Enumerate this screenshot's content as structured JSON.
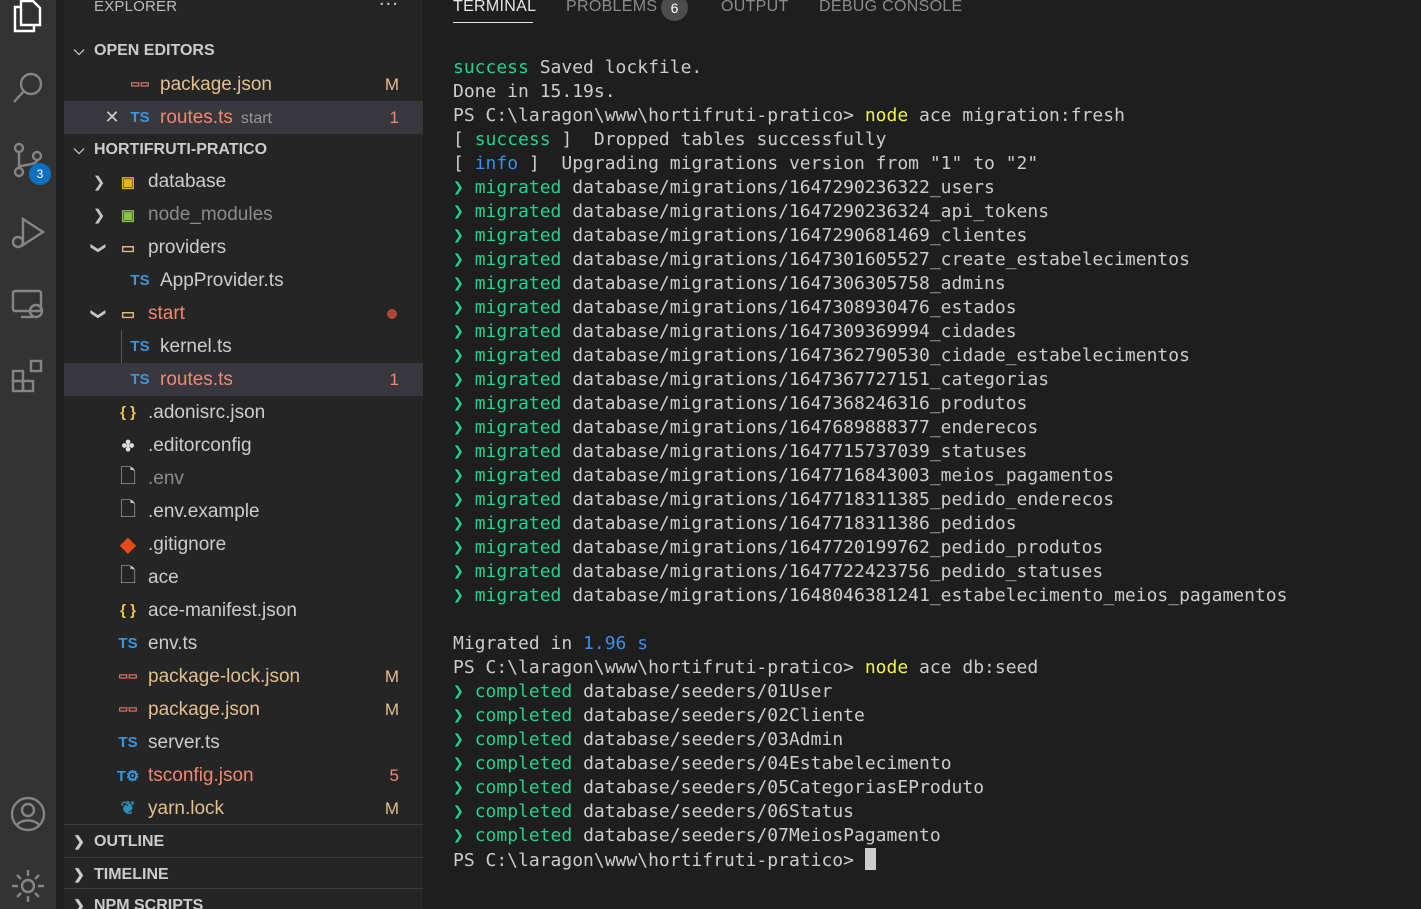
{
  "explorer": {
    "title": "EXPLORER",
    "more": "···",
    "open_editors": {
      "header": "OPEN EDITORS",
      "items": [
        {
          "label": "package.json",
          "decoration": "M",
          "icon": "json-icon"
        },
        {
          "label": "routes.ts",
          "sub": "start",
          "decoration": "1",
          "icon": "ts-icon"
        }
      ]
    },
    "project": {
      "header": "HORTIFRUTI-PRATICO",
      "items": [
        {
          "label": "database",
          "icon": "folder-database-icon"
        },
        {
          "label": "node_modules",
          "icon": "folder-node-icon"
        },
        {
          "label": "providers",
          "icon": "folder-open-icon"
        },
        {
          "label": "AppProvider.ts",
          "icon": "ts-icon"
        },
        {
          "label": "start",
          "icon": "folder-open-icon"
        },
        {
          "label": "kernel.ts",
          "icon": "ts-icon"
        },
        {
          "label": "routes.ts",
          "icon": "ts-icon",
          "decoration": "1"
        },
        {
          "label": ".adonisrc.json",
          "icon": "json-braces-icon"
        },
        {
          "label": ".editorconfig",
          "icon": "editorconfig-icon"
        },
        {
          "label": ".env",
          "icon": "file-icon"
        },
        {
          "label": ".env.example",
          "icon": "file-icon"
        },
        {
          "label": ".gitignore",
          "icon": "git-icon"
        },
        {
          "label": "ace",
          "icon": "file-icon"
        },
        {
          "label": "ace-manifest.json",
          "icon": "json-braces-icon"
        },
        {
          "label": "env.ts",
          "icon": "ts-icon"
        },
        {
          "label": "package-lock.json",
          "icon": "npm-icon",
          "decoration": "M"
        },
        {
          "label": "package.json",
          "icon": "npm-icon",
          "decoration": "M"
        },
        {
          "label": "server.ts",
          "icon": "ts-icon"
        },
        {
          "label": "tsconfig.json",
          "icon": "tsconfig-icon",
          "decoration": "5"
        },
        {
          "label": "yarn.lock",
          "icon": "yarn-icon",
          "decoration": "M"
        }
      ]
    },
    "outline": "OUTLINE",
    "timeline": "TIMELINE",
    "npm_scripts": "NPM SCRIPTS"
  },
  "activity_bar": {
    "source_control_badge": "3"
  },
  "panel": {
    "tabs": [
      "TERMINAL",
      "PROBLEMS",
      "OUTPUT",
      "DEBUG CONSOLE"
    ],
    "problems_count": "6"
  },
  "terminal": {
    "lines": [
      [
        {
          "t": "success",
          "c": "g"
        },
        {
          "t": " Saved lockfile."
        }
      ],
      [
        {
          "t": "Done in 15.19s."
        }
      ],
      [
        {
          "t": "PS C:\\laragon\\www\\hortifruti-pratico> "
        },
        {
          "t": "node",
          "c": "y"
        },
        {
          "t": " ace migration:fresh"
        }
      ],
      [
        {
          "t": "[ "
        },
        {
          "t": "success",
          "c": "g"
        },
        {
          "t": " ]  Dropped tables successfully"
        }
      ],
      [
        {
          "t": "[ "
        },
        {
          "t": "info",
          "c": "b"
        },
        {
          "t": " ]  Upgrading migrations version from \"1\" to \"2\""
        }
      ],
      [
        {
          "t": "❯ ",
          "c": "g"
        },
        {
          "t": "migrated",
          "c": "g"
        },
        {
          "t": " database/migrations/1647290236322_users"
        }
      ],
      [
        {
          "t": "❯ ",
          "c": "g"
        },
        {
          "t": "migrated",
          "c": "g"
        },
        {
          "t": " database/migrations/1647290236324_api_tokens"
        }
      ],
      [
        {
          "t": "❯ ",
          "c": "g"
        },
        {
          "t": "migrated",
          "c": "g"
        },
        {
          "t": " database/migrations/1647290681469_clientes"
        }
      ],
      [
        {
          "t": "❯ ",
          "c": "g"
        },
        {
          "t": "migrated",
          "c": "g"
        },
        {
          "t": " database/migrations/1647301605527_create_estabelecimentos"
        }
      ],
      [
        {
          "t": "❯ ",
          "c": "g"
        },
        {
          "t": "migrated",
          "c": "g"
        },
        {
          "t": " database/migrations/1647306305758_admins"
        }
      ],
      [
        {
          "t": "❯ ",
          "c": "g"
        },
        {
          "t": "migrated",
          "c": "g"
        },
        {
          "t": " database/migrations/1647308930476_estados"
        }
      ],
      [
        {
          "t": "❯ ",
          "c": "g"
        },
        {
          "t": "migrated",
          "c": "g"
        },
        {
          "t": " database/migrations/1647309369994_cidades"
        }
      ],
      [
        {
          "t": "❯ ",
          "c": "g"
        },
        {
          "t": "migrated",
          "c": "g"
        },
        {
          "t": " database/migrations/1647362790530_cidade_estabelecimentos"
        }
      ],
      [
        {
          "t": "❯ ",
          "c": "g"
        },
        {
          "t": "migrated",
          "c": "g"
        },
        {
          "t": " database/migrations/1647367727151_categorias"
        }
      ],
      [
        {
          "t": "❯ ",
          "c": "g"
        },
        {
          "t": "migrated",
          "c": "g"
        },
        {
          "t": " database/migrations/1647368246316_produtos"
        }
      ],
      [
        {
          "t": "❯ ",
          "c": "g"
        },
        {
          "t": "migrated",
          "c": "g"
        },
        {
          "t": " database/migrations/1647689888377_enderecos"
        }
      ],
      [
        {
          "t": "❯ ",
          "c": "g"
        },
        {
          "t": "migrated",
          "c": "g"
        },
        {
          "t": " database/migrations/1647715737039_statuses"
        }
      ],
      [
        {
          "t": "❯ ",
          "c": "g"
        },
        {
          "t": "migrated",
          "c": "g"
        },
        {
          "t": " database/migrations/1647716843003_meios_pagamentos"
        }
      ],
      [
        {
          "t": "❯ ",
          "c": "g"
        },
        {
          "t": "migrated",
          "c": "g"
        },
        {
          "t": " database/migrations/1647718311385_pedido_enderecos"
        }
      ],
      [
        {
          "t": "❯ ",
          "c": "g"
        },
        {
          "t": "migrated",
          "c": "g"
        },
        {
          "t": " database/migrations/1647718311386_pedidos"
        }
      ],
      [
        {
          "t": "❯ ",
          "c": "g"
        },
        {
          "t": "migrated",
          "c": "g"
        },
        {
          "t": " database/migrations/1647720199762_pedido_produtos"
        }
      ],
      [
        {
          "t": "❯ ",
          "c": "g"
        },
        {
          "t": "migrated",
          "c": "g"
        },
        {
          "t": " database/migrations/1647722423756_pedido_statuses"
        }
      ],
      [
        {
          "t": "❯ ",
          "c": "g"
        },
        {
          "t": "migrated",
          "c": "g"
        },
        {
          "t": " database/migrations/1648046381241_estabelecimento_meios_pagamentos"
        }
      ],
      [
        {
          "t": ""
        }
      ],
      [
        {
          "t": "Migrated in "
        },
        {
          "t": "1.96 s",
          "c": "b"
        }
      ],
      [
        {
          "t": "PS C:\\laragon\\www\\hortifruti-pratico> "
        },
        {
          "t": "node",
          "c": "y"
        },
        {
          "t": " ace db:seed"
        }
      ],
      [
        {
          "t": "❯ ",
          "c": "g"
        },
        {
          "t": "completed",
          "c": "g"
        },
        {
          "t": " database/seeders/01User"
        }
      ],
      [
        {
          "t": "❯ ",
          "c": "g"
        },
        {
          "t": "completed",
          "c": "g"
        },
        {
          "t": " database/seeders/02Cliente"
        }
      ],
      [
        {
          "t": "❯ ",
          "c": "g"
        },
        {
          "t": "completed",
          "c": "g"
        },
        {
          "t": " database/seeders/03Admin"
        }
      ],
      [
        {
          "t": "❯ ",
          "c": "g"
        },
        {
          "t": "completed",
          "c": "g"
        },
        {
          "t": " database/seeders/04Estabelecimento"
        }
      ],
      [
        {
          "t": "❯ ",
          "c": "g"
        },
        {
          "t": "completed",
          "c": "g"
        },
        {
          "t": " database/seeders/05CategoriasEProduto"
        }
      ],
      [
        {
          "t": "❯ ",
          "c": "g"
        },
        {
          "t": "completed",
          "c": "g"
        },
        {
          "t": " database/seeders/06Status"
        }
      ],
      [
        {
          "t": "❯ ",
          "c": "g"
        },
        {
          "t": "completed",
          "c": "g"
        },
        {
          "t": " database/seeders/07MeiosPagamento"
        }
      ]
    ],
    "prompt": "PS C:\\laragon\\www\\hortifruti-pratico> "
  },
  "colors": {
    "success_green": "#23d18b",
    "command_yellow": "#f5f543",
    "info_blue": "#3b8eea",
    "modified": "#e2c08d",
    "error_red": "#f48771"
  }
}
